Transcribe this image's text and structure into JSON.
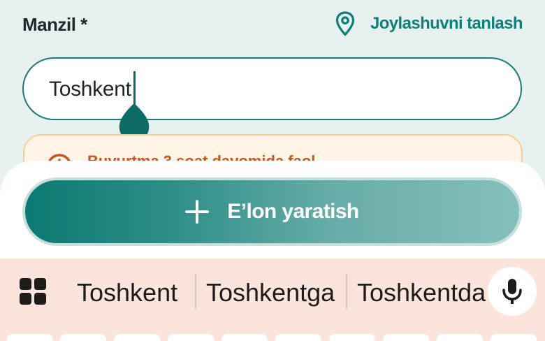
{
  "form": {
    "address_label": "Manzil *",
    "location_link": "Joylashuvni tanlash",
    "address_value": "Toshkent",
    "notice_text": "Buyurtma 3 soat davomida faol"
  },
  "actions": {
    "create_label": "E’lon yaratish"
  },
  "keyboard": {
    "suggestions": [
      "Toshkent",
      "Toshkentga",
      "Toshkentda"
    ]
  },
  "icons": {
    "location": "map-pin-icon",
    "notice": "clock-icon",
    "create": "plus-icon",
    "apps": "grid-icon",
    "voice": "microphone-icon"
  },
  "colors": {
    "accent": "#0f7f78",
    "notice_text": "#c9541c",
    "notice_bg": "#fff4e6",
    "keyboard_bg": "#fbe4dc"
  }
}
